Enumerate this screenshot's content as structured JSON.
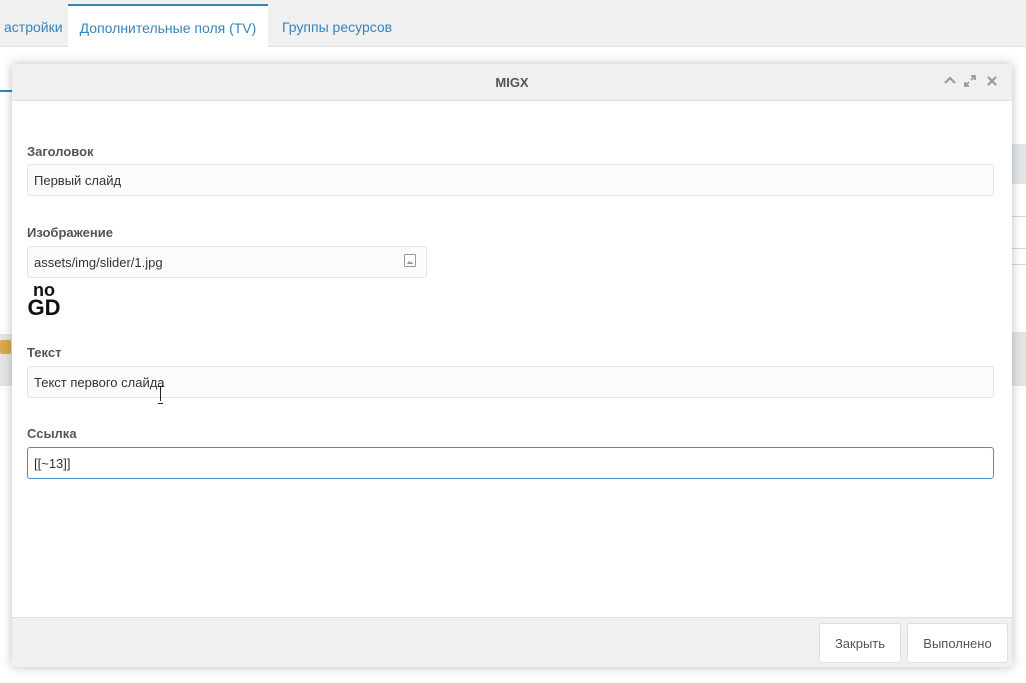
{
  "tabs": [
    {
      "label": "астройки"
    },
    {
      "label": "Дополнительные поля (TV)"
    },
    {
      "label": "Группы ресурсов"
    }
  ],
  "modal": {
    "title": "MIGX",
    "fields": {
      "title": {
        "label": "Заголовок",
        "value": "Первый слайд"
      },
      "image": {
        "label": "Изображение",
        "value": "assets/img/slider/1.jpg",
        "preview_small": "no",
        "preview_big": "GD"
      },
      "text": {
        "label": "Текст",
        "value": "Текст первого слайда"
      },
      "link": {
        "label": "Ссылка",
        "value": "[[~13]]"
      }
    },
    "buttons": {
      "close": "Закрыть",
      "done": "Выполнено"
    }
  },
  "icons": {
    "collapse": "chevron-up-icon",
    "expand": "expand-icon",
    "close": "close-icon",
    "browse": "image-file-icon"
  },
  "colors": {
    "accent": "#3584ba",
    "active_input_border": "#4a8ec9",
    "header_bg": "#f0f0f0"
  }
}
